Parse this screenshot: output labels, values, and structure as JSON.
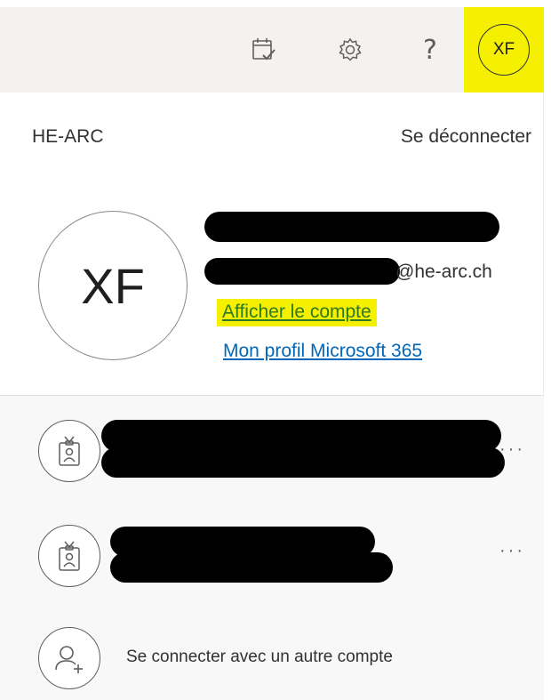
{
  "header": {
    "calendar_icon": "calendar-check-icon",
    "settings_icon": "gear-icon",
    "help_label": "?",
    "avatar_initials": "XF",
    "avatar_highlight_color": "#f5ef00"
  },
  "profile": {
    "organization": "HE-ARC",
    "sign_out_label": "Se déconnecter",
    "initials": "XF",
    "email_domain": "@he-arc.ch",
    "view_account_label": "Afficher le compte",
    "m365_profile_label": "Mon profil Microsoft 365"
  },
  "accounts": {
    "more_label": "···",
    "add_account_label": "Se connecter avec un autre compte"
  },
  "colors": {
    "link": "#0067b8",
    "highlight": "#f5ef00",
    "panel_bg": "#f8f8f8"
  }
}
